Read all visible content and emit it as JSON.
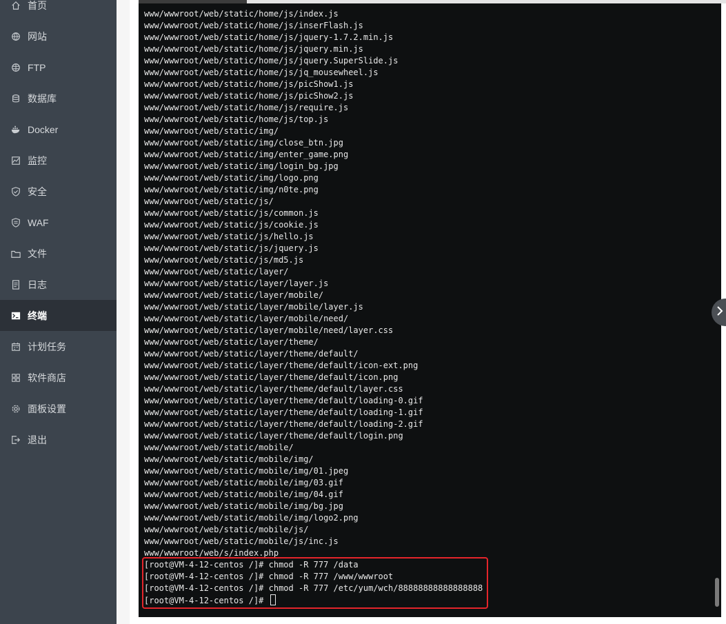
{
  "sidebar": {
    "items": [
      {
        "label": "首页",
        "icon": "home-icon"
      },
      {
        "label": "网站",
        "icon": "globe-icon"
      },
      {
        "label": "FTP",
        "icon": "ftp-globe-icon"
      },
      {
        "label": "数据库",
        "icon": "database-icon"
      },
      {
        "label": "Docker",
        "icon": "docker-icon"
      },
      {
        "label": "监控",
        "icon": "monitor-icon"
      },
      {
        "label": "安全",
        "icon": "shield-icon"
      },
      {
        "label": "WAF",
        "icon": "waf-shield-icon"
      },
      {
        "label": "文件",
        "icon": "folder-icon"
      },
      {
        "label": "日志",
        "icon": "log-icon"
      },
      {
        "label": "终端",
        "icon": "terminal-icon",
        "active": true
      },
      {
        "label": "计划任务",
        "icon": "calendar-icon"
      },
      {
        "label": "软件商店",
        "icon": "apps-icon"
      },
      {
        "label": "面板设置",
        "icon": "gear-icon"
      },
      {
        "label": "退出",
        "icon": "logout-icon"
      }
    ]
  },
  "terminal": {
    "lines": [
      "www/wwwroot/web/static/home/js/index.js",
      "www/wwwroot/web/static/home/js/inserFlash.js",
      "www/wwwroot/web/static/home/js/jquery-1.7.2.min.js",
      "www/wwwroot/web/static/home/js/jquery.min.js",
      "www/wwwroot/web/static/home/js/jquery.SuperSlide.js",
      "www/wwwroot/web/static/home/js/jq_mousewheel.js",
      "www/wwwroot/web/static/home/js/picShow1.js",
      "www/wwwroot/web/static/home/js/picShow2.js",
      "www/wwwroot/web/static/home/js/require.js",
      "www/wwwroot/web/static/home/js/top.js",
      "www/wwwroot/web/static/img/",
      "www/wwwroot/web/static/img/close_btn.jpg",
      "www/wwwroot/web/static/img/enter_game.png",
      "www/wwwroot/web/static/img/login_bg.jpg",
      "www/wwwroot/web/static/img/logo.png",
      "www/wwwroot/web/static/img/n0te.png",
      "www/wwwroot/web/static/js/",
      "www/wwwroot/web/static/js/common.js",
      "www/wwwroot/web/static/js/cookie.js",
      "www/wwwroot/web/static/js/hello.js",
      "www/wwwroot/web/static/js/jquery.js",
      "www/wwwroot/web/static/js/md5.js",
      "www/wwwroot/web/static/layer/",
      "www/wwwroot/web/static/layer/layer.js",
      "www/wwwroot/web/static/layer/mobile/",
      "www/wwwroot/web/static/layer/mobile/layer.js",
      "www/wwwroot/web/static/layer/mobile/need/",
      "www/wwwroot/web/static/layer/mobile/need/layer.css",
      "www/wwwroot/web/static/layer/theme/",
      "www/wwwroot/web/static/layer/theme/default/",
      "www/wwwroot/web/static/layer/theme/default/icon-ext.png",
      "www/wwwroot/web/static/layer/theme/default/icon.png",
      "www/wwwroot/web/static/layer/theme/default/layer.css",
      "www/wwwroot/web/static/layer/theme/default/loading-0.gif",
      "www/wwwroot/web/static/layer/theme/default/loading-1.gif",
      "www/wwwroot/web/static/layer/theme/default/loading-2.gif",
      "www/wwwroot/web/static/layer/theme/default/login.png",
      "www/wwwroot/web/static/mobile/",
      "www/wwwroot/web/static/mobile/img/",
      "www/wwwroot/web/static/mobile/img/01.jpeg",
      "www/wwwroot/web/static/mobile/img/03.gif",
      "www/wwwroot/web/static/mobile/img/04.gif",
      "www/wwwroot/web/static/mobile/img/bg.jpg",
      "www/wwwroot/web/static/mobile/img/logo2.png",
      "www/wwwroot/web/static/mobile/js/",
      "www/wwwroot/web/static/mobile/js/inc.js",
      "www/wwwroot/web/s/index.php",
      "[root@VM-4-12-centos /]# chmod -R 777 /data",
      "[root@VM-4-12-centos /]# chmod -R 777 /www/wwwroot",
      "[root@VM-4-12-centos /]# chmod -R 777 /etc/yum/wch/88888888888888888",
      "[root@VM-4-12-centos /]# "
    ]
  },
  "colors": {
    "sidebar_bg": "#3c444d",
    "sidebar_active_bg": "#2c3138",
    "terminal_bg": "#0e1011",
    "terminal_fg": "#e9e9e9",
    "highlight_border": "#e5252b"
  }
}
